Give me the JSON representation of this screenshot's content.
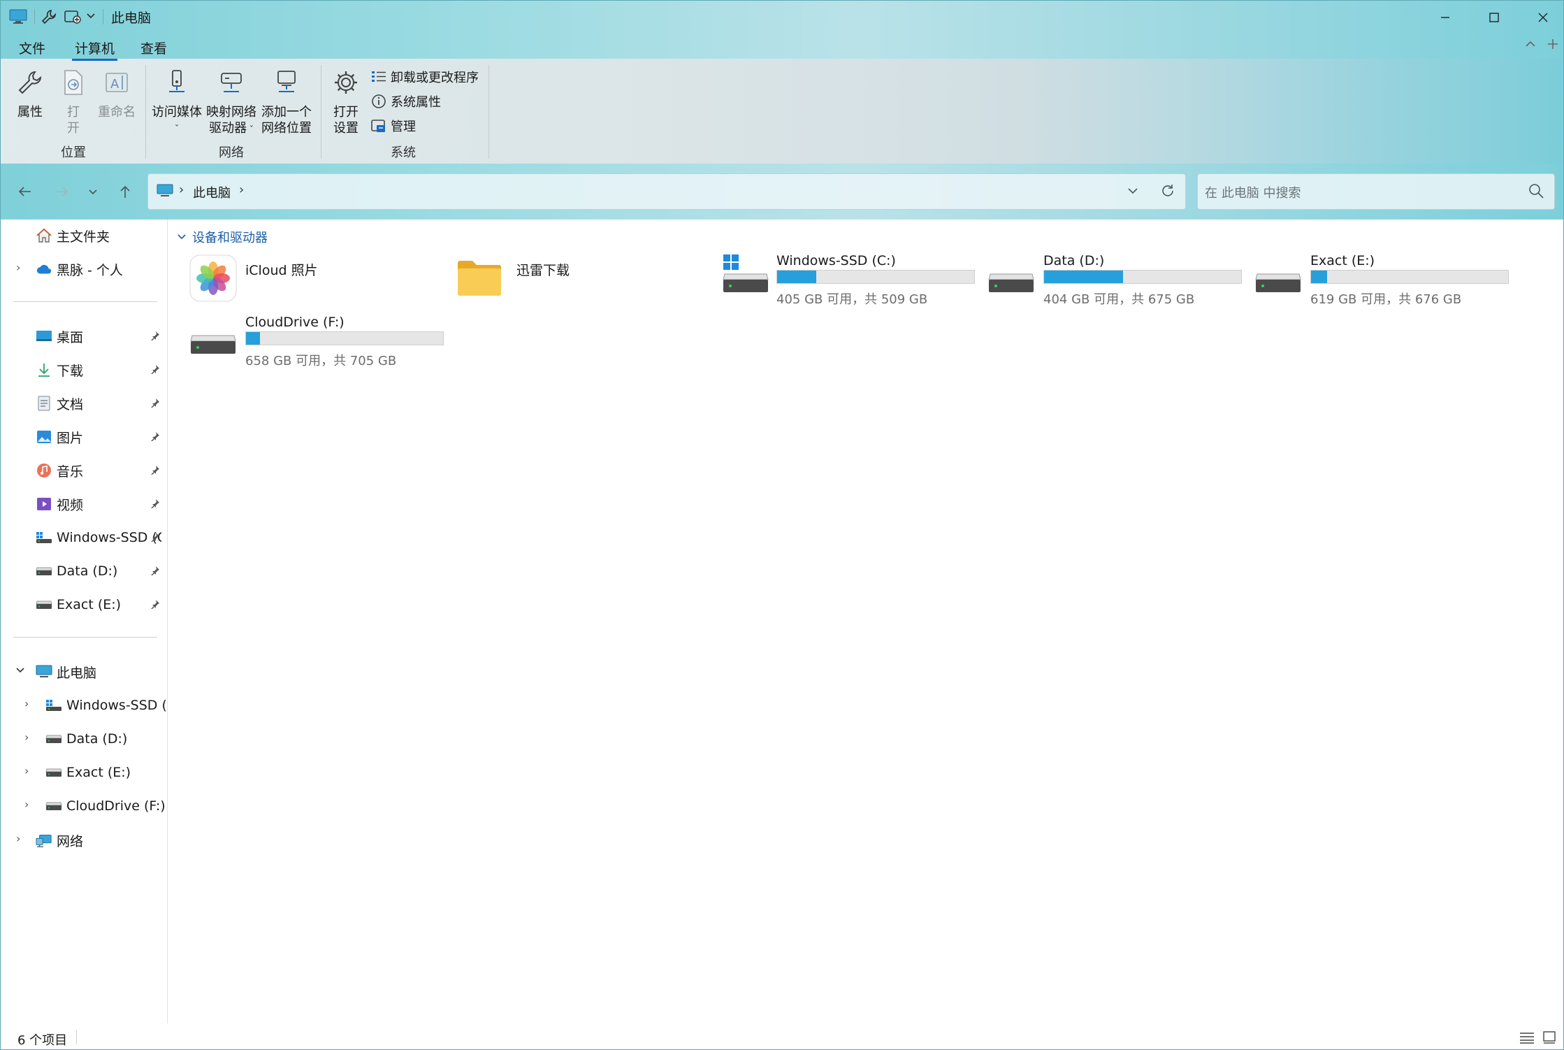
{
  "window": {
    "title": "此电脑",
    "controls": [
      "minimize-icon",
      "maximize-icon",
      "close-icon"
    ]
  },
  "menu": {
    "file": "文件",
    "computer": "计算机",
    "view": "查看",
    "active": "计算机"
  },
  "ribbon": {
    "location_group": "位置",
    "network_group": "网络",
    "system_group": "系统",
    "properties": "属性",
    "open_line1": "打",
    "open_line2": "开",
    "rename": "重命名",
    "access_media": "访问媒体",
    "map_drive_line1": "映射网络",
    "map_drive_line2": "驱动器",
    "add_location_line1": "添加一个",
    "add_location_line2": "网络位置",
    "open_settings_line1": "打开",
    "open_settings_line2": "设置",
    "uninstall": "卸载或更改程序",
    "system_properties": "系统属性",
    "manage": "管理"
  },
  "address": {
    "location": "此电脑",
    "search_placeholder": "在 此电脑 中搜索"
  },
  "sidebar": {
    "home": "主文件夹",
    "onedrive": "黑脉 - 个人",
    "pinned": [
      {
        "label": "桌面",
        "icon": "desktop-icon"
      },
      {
        "label": "下载",
        "icon": "download-icon"
      },
      {
        "label": "文档",
        "icon": "document-icon"
      },
      {
        "label": "图片",
        "icon": "pictures-icon"
      },
      {
        "label": "音乐",
        "icon": "music-icon"
      },
      {
        "label": "视频",
        "icon": "video-icon"
      },
      {
        "label": "Windows-SSD (C:)",
        "icon": "drive-icon"
      },
      {
        "label": "Data (D:)",
        "icon": "drive-icon"
      },
      {
        "label": "Exact (E:)",
        "icon": "drive-icon"
      }
    ],
    "this_pc": "此电脑",
    "drives": [
      {
        "label": "Windows-SSD (C:)"
      },
      {
        "label": "Data (D:)"
      },
      {
        "label": "Exact (E:)"
      },
      {
        "label": "CloudDrive (F:)"
      }
    ],
    "network": "网络"
  },
  "content": {
    "section": "设备和驱动器",
    "items": [
      {
        "name": "iCloud 照片",
        "type": "app"
      },
      {
        "name": "迅雷下载",
        "type": "folder"
      },
      {
        "name": "Windows-SSD (C:)",
        "free": "405 GB 可用，共 509 GB",
        "used_fraction": 0.2
      },
      {
        "name": "Data (D:)",
        "free": "404 GB 可用，共 675 GB",
        "used_fraction": 0.4
      },
      {
        "name": "Exact (E:)",
        "free": "619 GB 可用，共 676 GB",
        "used_fraction": 0.08
      },
      {
        "name": "CloudDrive (F:)",
        "free": "658 GB 可用，共 705 GB",
        "used_fraction": 0.07
      }
    ]
  },
  "status": {
    "count": "6 个项目"
  },
  "colors": {
    "accent": "#1b6ac2",
    "drive_bar": "#26a0da",
    "folder": "#f7c64a"
  }
}
